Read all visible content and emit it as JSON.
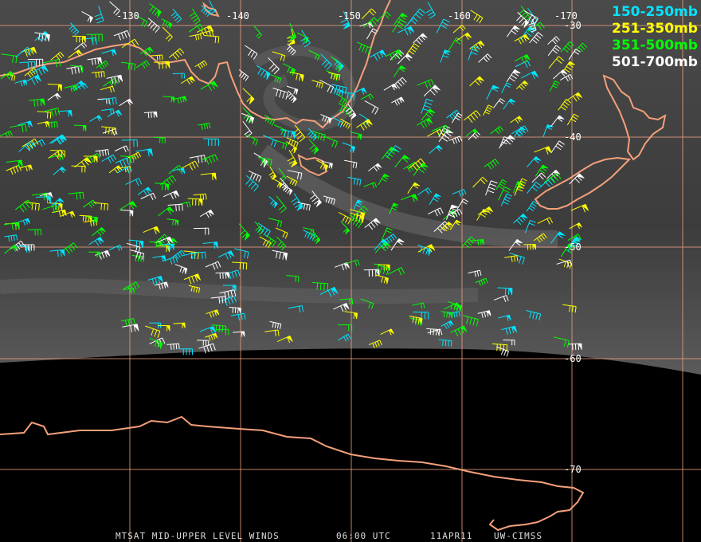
{
  "footer": {
    "satellite": "MTSAT MID-UPPER LEVEL WINDS",
    "time": "06:00 UTC",
    "date": "11APR11",
    "source": "UW-CIMSS"
  },
  "legend": [
    {
      "label": "150-250mb",
      "color": "#00e5ff"
    },
    {
      "label": "251-350mb",
      "color": "#ffff00"
    },
    {
      "label": "351-500mb",
      "color": "#00ff00"
    },
    {
      "label": "501-700mb",
      "color": "#ffffff"
    }
  ],
  "longitude_labels": [
    "-130",
    "-140",
    "-150",
    "-160",
    "-170"
  ],
  "latitude_labels": [
    "-30",
    "-40",
    "-50",
    "-60",
    "-70"
  ],
  "colors": {
    "grid": "#f0a080",
    "coastline": "#f4a07a",
    "background": "#000000",
    "cloud_field": "#3a3a3a"
  }
}
